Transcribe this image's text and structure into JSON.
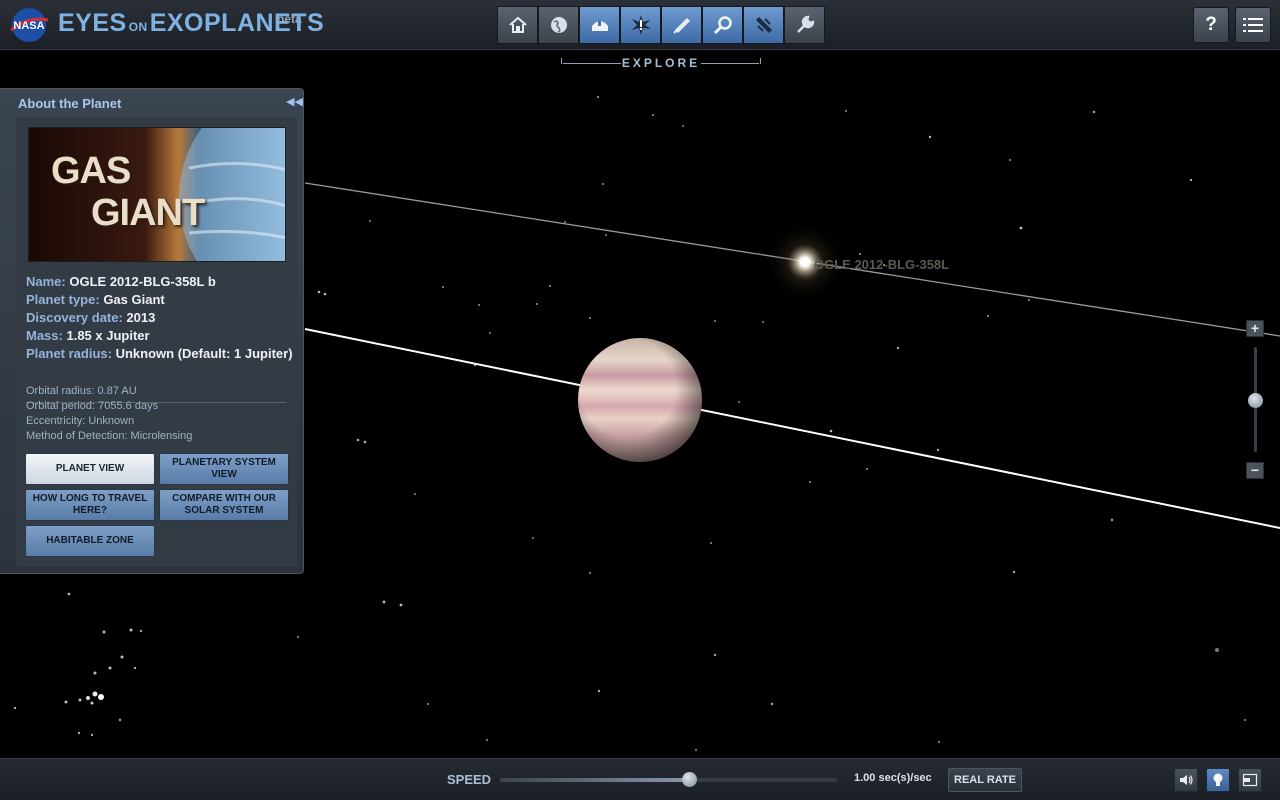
{
  "header": {
    "logo_text": "NASA",
    "app_title_part1": "EYES",
    "app_title_part2": "ON",
    "app_title_part3": "EXOPLANETS",
    "beta": "beta",
    "section_label": "EXPLORE",
    "toolbar": [
      {
        "name": "home-icon",
        "active": false
      },
      {
        "name": "globe-icon",
        "active": false
      },
      {
        "name": "observatory-icon",
        "active": true
      },
      {
        "name": "discovery-burst-icon",
        "active": true
      },
      {
        "name": "telescope-icon",
        "active": true
      },
      {
        "name": "search-magnifier-icon",
        "active": true
      },
      {
        "name": "spacecraft-icon",
        "active": true
      },
      {
        "name": "wrench-icon",
        "active": false
      }
    ],
    "help_label": "?",
    "menu_icon": "list-icon"
  },
  "panel": {
    "title": "About the Planet",
    "collapse_glyph": "◀◀",
    "thumbnail": {
      "line1": "GAS",
      "line2": "GIANT"
    },
    "info": [
      {
        "key": "Name:",
        "value": "OGLE 2012-BLG-358L b"
      },
      {
        "key": "Planet type:",
        "value": "Gas Giant"
      },
      {
        "key": "Discovery date:",
        "value": "2013"
      },
      {
        "key": "Mass:",
        "value": "1.85 x Jupiter"
      },
      {
        "key": "Planet radius:",
        "value": "Unknown (Default: 1 Jupiter)"
      }
    ],
    "details": [
      "Orbital radius: 0.87 AU",
      "Orbital period: 7055.6 days",
      "Eccentricity: Unknown",
      "Method of Detection: Microlensing"
    ],
    "buttons": {
      "planet_view": "PLANET VIEW",
      "system_view": "PLANETARY SYSTEM VIEW",
      "travel": "HOW LONG TO TRAVEL HERE?",
      "compare": "COMPARE WITH OUR SOLAR SYSTEM",
      "habitable": "HABITABLE ZONE"
    }
  },
  "scene": {
    "star_label": "OGLE 2012-BLG-358L"
  },
  "zoom": {
    "plus": "+",
    "minus": "−",
    "level": 0.5
  },
  "bottom": {
    "speed_label": "SPEED",
    "speed_fraction": 0.56,
    "speed_value": "1.00 sec(s)/sec",
    "real_rate": "REAL RATE",
    "icons": [
      "speaker-icon",
      "lightbulb-icon",
      "window-icon"
    ]
  }
}
